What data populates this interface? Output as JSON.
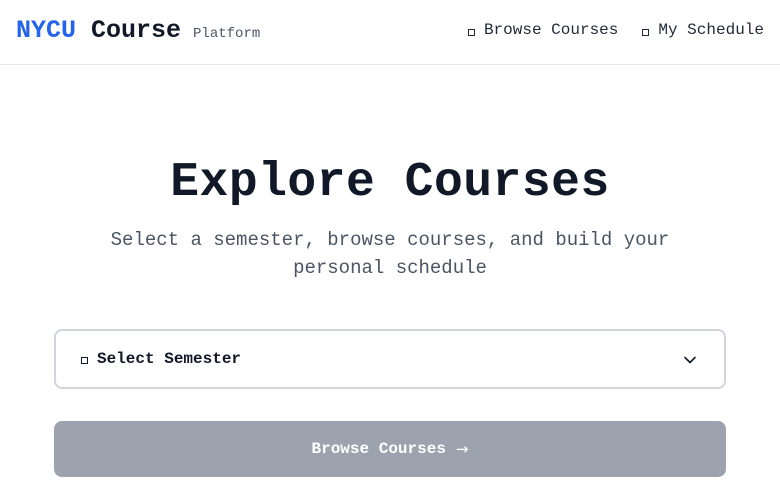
{
  "header": {
    "brand_primary": "NYCU",
    "brand_secondary": "Course",
    "brand_tag": "Platform",
    "nav": [
      {
        "label": "Browse Courses",
        "icon": "square-icon"
      },
      {
        "label": "My Schedule",
        "icon": "square-icon"
      }
    ]
  },
  "hero": {
    "title": "Explore Courses",
    "subtitle": "Select a semester, browse courses, and build your personal schedule"
  },
  "semester_select": {
    "label": "Select Semester",
    "icon": "square-icon",
    "dropdown_icon": "chevron-down-icon"
  },
  "browse_button": {
    "label": "Browse Courses",
    "arrow": "→",
    "state": "disabled"
  },
  "colors": {
    "brand_accent": "#2563eb",
    "button_disabled": "#9ca3af",
    "text_primary": "#111827",
    "text_muted": "#4b5563",
    "border": "#d1d5db"
  }
}
